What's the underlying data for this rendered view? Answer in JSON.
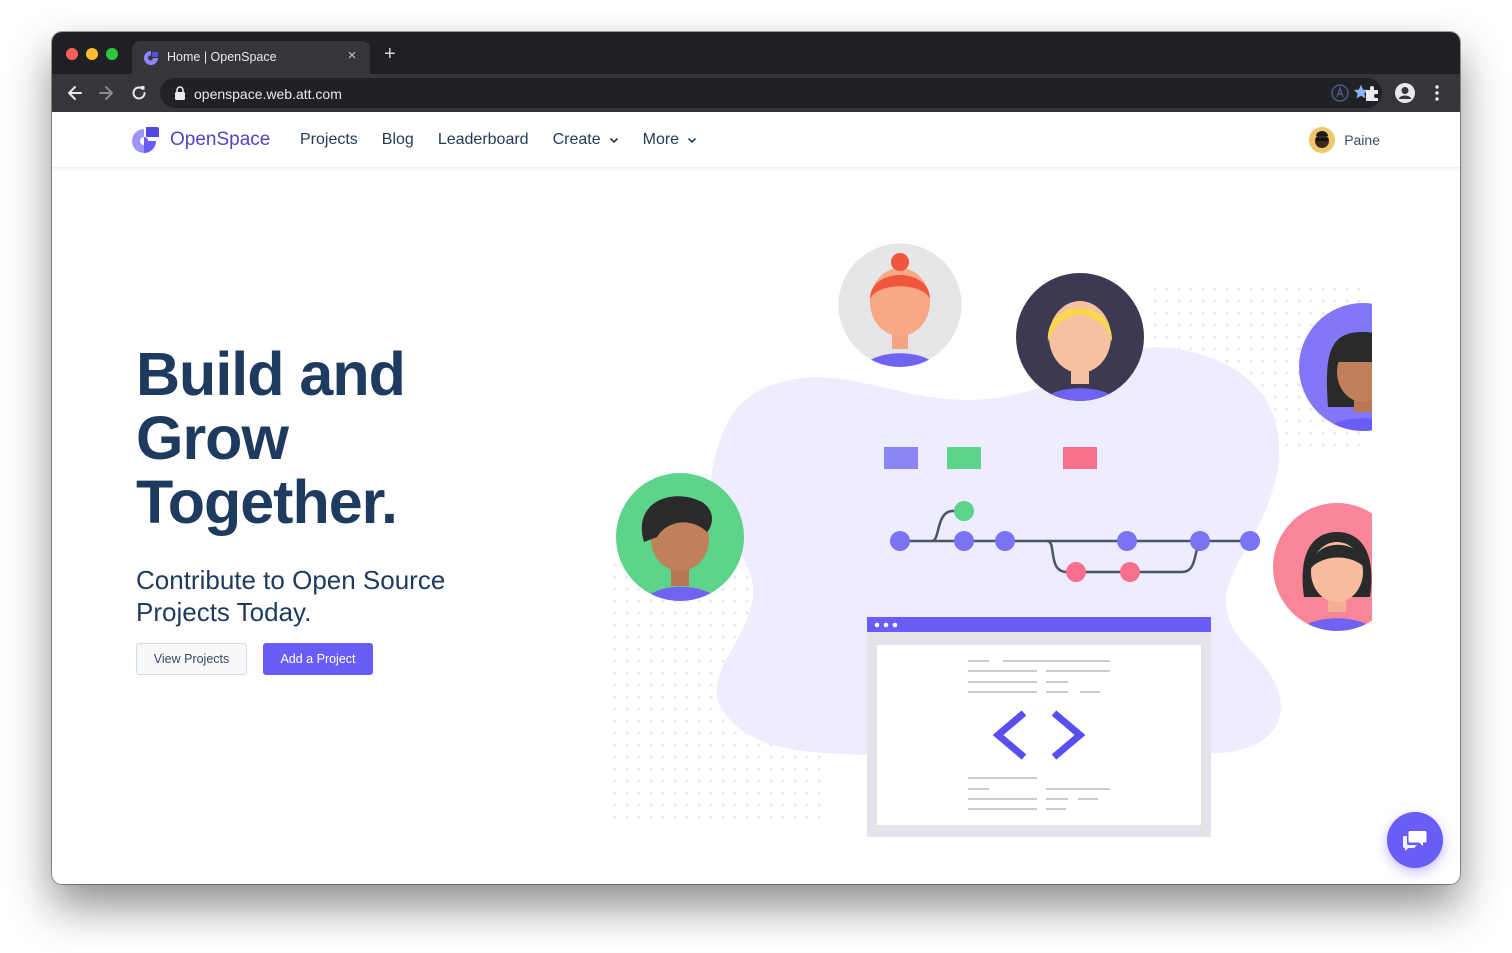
{
  "browser": {
    "tab_title": "Home | OpenSpace",
    "tab_close": "×",
    "new_tab": "+",
    "url": "openspace.web.att.com"
  },
  "navbar": {
    "brand": "OpenSpace",
    "links": [
      {
        "label": "Projects"
      },
      {
        "label": "Blog"
      },
      {
        "label": "Leaderboard"
      },
      {
        "label": "Create"
      },
      {
        "label": "More"
      }
    ],
    "user_name": "Paine"
  },
  "hero": {
    "title_line1": "Build and",
    "title_line2": "Grow",
    "title_line3": "Together.",
    "subtitle_line1": "Contribute to Open Source",
    "subtitle_line2": "Projects Today.",
    "secondary_button": "View Projects",
    "primary_button": "Add a Project"
  },
  "colors": {
    "brand": "#4e46c8",
    "primary": "#6a5cf6",
    "heading": "#1e3a5f",
    "blob": "#eeedfd"
  },
  "icons": [
    "back-icon",
    "forward-icon",
    "reload-icon",
    "lock-icon",
    "star-icon",
    "extensions-icon",
    "profile-icon",
    "menu-icon",
    "chat-icon"
  ]
}
